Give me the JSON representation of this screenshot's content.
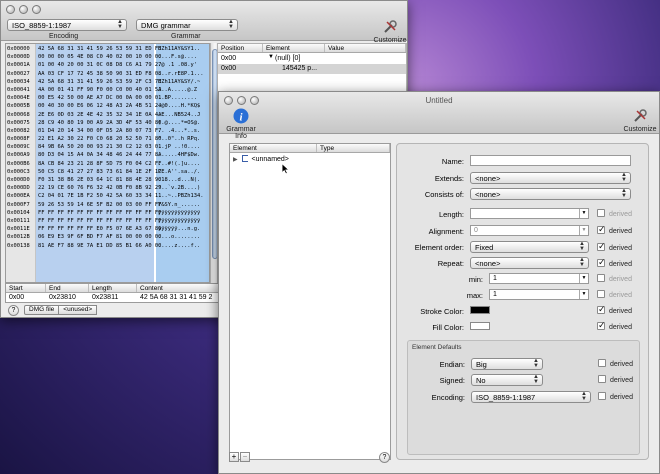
{
  "main_window": {
    "title": "",
    "encoding_value": "ISO_8859-1:1987",
    "encoding_label": "Encoding",
    "grammar_value": "DMG grammar",
    "grammar_label": "Grammar",
    "customize_label": "Customize",
    "hex_rows": [
      {
        "off": "0x00000",
        "hex": "42 5A 68 31 31 41 59 26 53 59 31 ED F8",
        "asc": "BZh11AY&SY1.."
      },
      {
        "off": "0x0000D",
        "hex": "00 00 00 05 4E 08 C0 40 02 00 10 00 00",
        "asc": "....F.s@...."
      },
      {
        "off": "0x0001A",
        "hex": "01 00 40 20 00 31 0C 08 D8 C6 A1 79 27",
        "asc": ".@ .1 .08.y'"
      },
      {
        "off": "0x00027",
        "hex": "AA 03 CF 17 72 45 38 50 90 31 ED F8 08",
        "asc": "...r.rE8P.1..."
      },
      {
        "off": "0x00034",
        "hex": "42 5A 68 31 31 41 59 26 53 59 2F C3 7E",
        "asc": "BZh11AY&SY/.~"
      },
      {
        "off": "0x00041",
        "hex": "4A 00 01 41 FF 90 F0 00 C0 00 40 01 5A",
        "asc": "J..A.....@.Z"
      },
      {
        "off": "0x0004E",
        "hex": "00 E5 42 50 00 AE A7 DC 00 0A 00 00 01",
        "asc": "..BP........"
      },
      {
        "off": "0x0005B",
        "hex": "00 40 30 00 E6 06 12 48 A3 2A 4B 51 24",
        "asc": ".@0....H.*KQ$"
      },
      {
        "off": "0x00068",
        "hex": "2E E6 0D 03 2E 4E 42 35 32 34 1E 0A 4A",
        "asc": ".E...NB524..J"
      },
      {
        "off": "0x00075",
        "hex": "28 C9 40 80 19 00 A9 2A 3D 4F 53 40 80",
        "asc": "(.@....*=OS@."
      },
      {
        "off": "0x00082",
        "hex": "01 D4 20 14 34 00 0F D5 2A 80 07 73 F7",
        "asc": ".. .4...*..s."
      },
      {
        "off": "0x0008F",
        "hex": "22 E1 A2 30 22 F0 C0 68 20 52 50 71 80",
        "asc": "\"..0\"..h RPq."
      },
      {
        "off": "0x0009C",
        "hex": "84 9B 6A 50 20 00 93 21 30 C2 12 03 01",
        "asc": "..jP ..!0...."
      },
      {
        "off": "0x000A9",
        "hex": "80 D3 04 15 A4 0A 34 48 46 24 44 77 8A",
        "asc": "......4HF$Dw."
      },
      {
        "off": "0x000B6",
        "hex": "8A CB 84 23 21 28 8F 5D 75 F0 04 C2 FF",
        "asc": "...#!(.]u...."
      },
      {
        "off": "0x000C3",
        "hex": "50 C5 C8 41 27 27 83 73 61 84 1E 2F 1C",
        "asc": "PE.A''.sa../."
      },
      {
        "off": "0x000D0",
        "hex": "F0 31 38 B6 2E 03 64 1C 81 88 4E 28 90",
        "asc": ".18...d...N(."
      },
      {
        "off": "0x000DD",
        "hex": "22 19 CE 60 76 F6 32 42 0B F0 8B 92 29",
        "asc": "\"..`v.2B....)"
      },
      {
        "off": "0x000EA",
        "hex": "C2 04 01 7E 1B F2 50 42 5A 60 33 34 11",
        "asc": "...~..PBZh134."
      },
      {
        "off": "0x000F7",
        "hex": "59 26 53 59 14 6E 5F B2 00 03 00 FF FF",
        "asc": "Y&SY.n_......"
      },
      {
        "off": "0x00104",
        "hex": "FF FF FF FF FF FF FF FF FF FF FF FF FF",
        "asc": "ÿÿÿÿÿÿÿÿÿÿÿÿÿ"
      },
      {
        "off": "0x00111",
        "hex": "FF FF FF FF FF FF FF FF FF FF FF FF FF",
        "asc": "ÿÿÿÿÿÿÿÿÿÿÿÿÿ"
      },
      {
        "off": "0x0011E",
        "hex": "FF FF FF FF FF FF E0 F5 07 6E A3 67 86",
        "asc": "ÿÿÿÿÿÿ...n.g."
      },
      {
        "off": "0x0012B",
        "hex": "06 E9 E3 9F 6F BD F7 AF 81 00 00 00 00",
        "asc": "....o........"
      },
      {
        "off": "0x00138",
        "hex": "81 AE F7 88 9E 7A E1 DD 85 B1 66 A0 00",
        "asc": ".....z....f.."
      }
    ],
    "struct_headers": [
      "Position",
      "Element",
      "Value"
    ],
    "struct_rows": [
      {
        "pos": "0x00",
        "elem": "(null) [0]",
        "val": ""
      },
      {
        "pos": "0x00",
        "elem": "",
        "val": "145425 p..."
      }
    ],
    "sel_headers": [
      "Start",
      "End",
      "Length",
      "Content"
    ],
    "sel_row": {
      "start": "0x00",
      "end": "0x23810",
      "length": "0x23811",
      "content": "42 5A 68 31 31 41 59 2"
    },
    "help_label": "?",
    "crumb_file": "DMG file",
    "crumb_unused": "<unused>"
  },
  "grammar_window": {
    "title": "Untitled",
    "grammar_info_label": "Grammar Info",
    "customize_label": "Customize",
    "tree_headers": [
      "Element",
      "Type"
    ],
    "tree_item": "<unnamed>",
    "add_label": "+",
    "remove_label": "−",
    "help_label": "?",
    "form": {
      "name_label": "Name:",
      "name_value": "",
      "extends_label": "Extends:",
      "extends_value": "<none>",
      "consists_label": "Consists of:",
      "consists_value": "<none>",
      "length_label": "Length:",
      "length_value": "",
      "alignment_label": "Alignment:",
      "alignment_value": "0",
      "order_label": "Element order:",
      "order_value": "Fixed",
      "repeat_label": "Repeat:",
      "repeat_value": "<none>",
      "min_label": "min:",
      "min_value": "1",
      "max_label": "max:",
      "max_value": "1",
      "stroke_label": "Stroke Color:",
      "fill_label": "Fill Color:",
      "derived_label": "derived",
      "defaults_title": "Element Defaults",
      "endian_label": "Endian:",
      "endian_value": "Big",
      "signed_label": "Signed:",
      "signed_value": "No",
      "encoding_label": "Encoding:",
      "encoding_value": "ISO_8859-1:1987"
    }
  },
  "colors": {
    "stroke_color": "#000000",
    "fill_color": "#ffffff",
    "selection": "#b8d0ef",
    "ascii_bg": "#a9cdf0"
  }
}
